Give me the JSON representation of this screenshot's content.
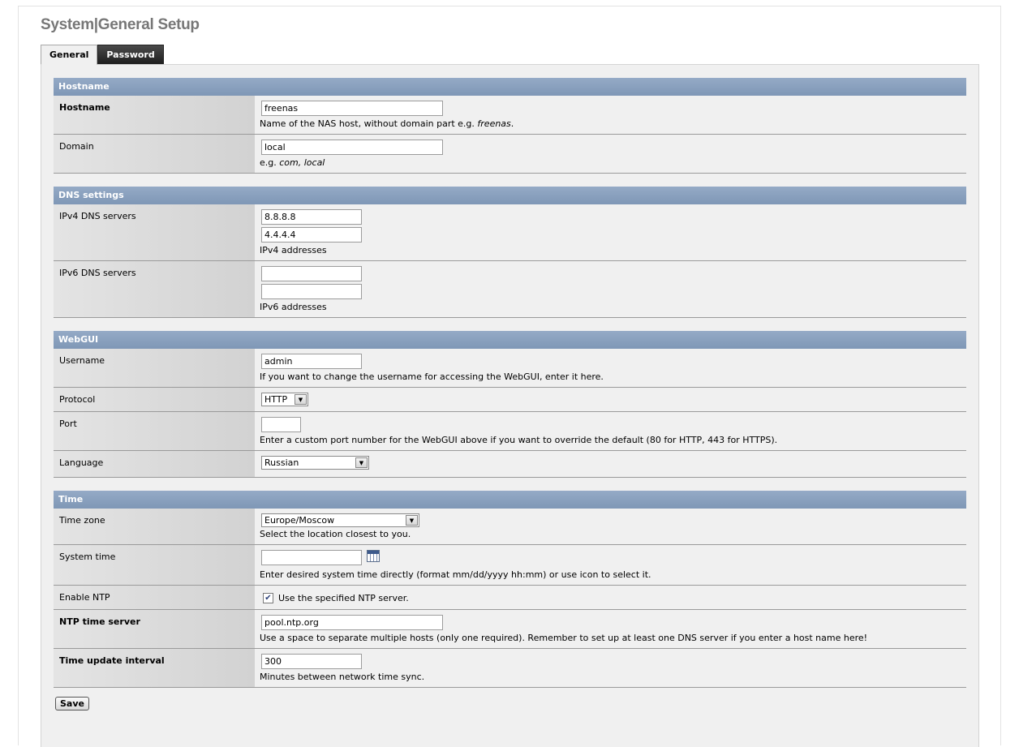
{
  "page": {
    "title": "System|General Setup"
  },
  "tabs": [
    {
      "label": "General",
      "active": true
    },
    {
      "label": "Password",
      "active": false
    }
  ],
  "sections": {
    "hostname": {
      "header": "Hostname",
      "hostname": {
        "label": "Hostname",
        "value": "freenas",
        "hint_prefix": "Name of the NAS host, without domain part e.g. ",
        "hint_example": "freenas",
        "hint_suffix": "."
      },
      "domain": {
        "label": "Domain",
        "value": "local",
        "hint_prefix": "e.g. ",
        "hint_example": "com, local"
      }
    },
    "dns": {
      "header": "DNS settings",
      "ipv4": {
        "label": "IPv4 DNS servers",
        "value1": "8.8.8.8",
        "value2": "4.4.4.4",
        "hint": "IPv4 addresses"
      },
      "ipv6": {
        "label": "IPv6 DNS servers",
        "value1": "",
        "value2": "",
        "hint": "IPv6 addresses"
      }
    },
    "webgui": {
      "header": "WebGUI",
      "username": {
        "label": "Username",
        "value": "admin",
        "hint": "If you want to change the username for accessing the WebGUI, enter it here."
      },
      "protocol": {
        "label": "Protocol",
        "value": "HTTP"
      },
      "port": {
        "label": "Port",
        "value": "",
        "hint": "Enter a custom port number for the WebGUI above if you want to override the default (80 for HTTP, 443 for HTTPS)."
      },
      "language": {
        "label": "Language",
        "value": "Russian"
      }
    },
    "time": {
      "header": "Time",
      "timezone": {
        "label": "Time zone",
        "value": "Europe/Moscow",
        "hint": "Select the location closest to you."
      },
      "system_time": {
        "label": "System time",
        "value": "",
        "hint": "Enter desired system time directly (format mm/dd/yyyy hh:mm) or use icon to select it."
      },
      "enable_ntp": {
        "label": "Enable NTP",
        "checked": true,
        "checkbox_label": "Use the specified NTP server."
      },
      "ntp_server": {
        "label": "NTP time server",
        "value": "pool.ntp.org",
        "hint": "Use a space to separate multiple hosts (only one required). Remember to set up at least one DNS server if you enter a host name here!"
      },
      "update_interval": {
        "label": "Time update interval",
        "value": "300",
        "hint": "Minutes between network time sync."
      }
    }
  },
  "actions": {
    "save_label": "Save"
  },
  "icons": {
    "select_arrow": "chevron-down-icon",
    "calendar": "calendar-icon",
    "checkmark": "check-icon"
  },
  "colors": {
    "section_header": "#8ba0bd",
    "label_bg": "#dcdcdc",
    "content_bg": "#f0f0f0",
    "tab_inactive": "#2a2a2a"
  }
}
